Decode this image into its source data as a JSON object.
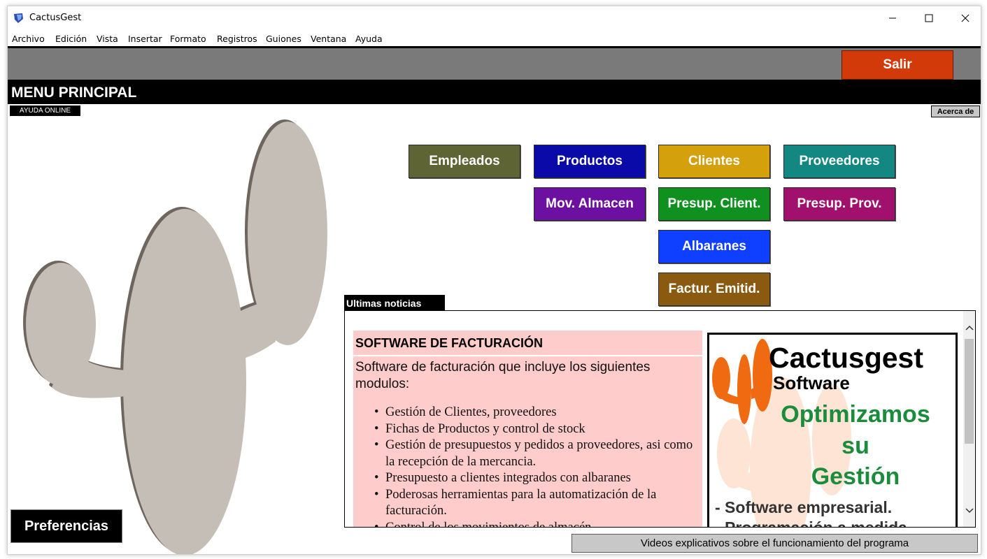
{
  "window": {
    "title": "CactusGest"
  },
  "menubar": {
    "items": [
      "Archivo",
      "Edición",
      "Vista",
      "Insertar",
      "Formato",
      "Registros",
      "Guiones",
      "Ventana",
      "Ayuda"
    ]
  },
  "toolbar": {
    "exit_label": "Salir"
  },
  "header": {
    "title": "MENU PRINCIPAL",
    "help_online": "AYUDA ONLINE",
    "about": "Acerca de"
  },
  "menu_buttons": {
    "empleados": "Empleados",
    "productos": "Productos",
    "clientes": "Clientes",
    "proveedores": "Proveedores",
    "mov_almacen": "Mov. Almacen",
    "presup_client": "Presup. Client.",
    "presup_prov": "Presup. Prov.",
    "albaranes": "Albaranes",
    "factur_emitid": "Factur. Emitid."
  },
  "colors": {
    "empleados": "#5f6435",
    "productos": "#0a0aa8",
    "clientes": "#d4a00c",
    "proveedores": "#138782",
    "mov_almacen": "#6b10a0",
    "presup_client": "#10901e",
    "presup_prov": "#a0106c",
    "albaranes": "#1040ff",
    "factur_emitid": "#8a5a10",
    "salir": "#d23a0a",
    "cactus": "#c5beb6"
  },
  "news": {
    "tab_label": "Ultimas noticias",
    "heading": "SOFTWARE DE FACTURACIÓN",
    "intro": "Software de facturación que incluye los siguientes modulos:",
    "items": [
      "Gestión de Clientes, proveedores",
      "Fichas de Productos y control de stock",
      "Gestión de presupuestos y pedidos a proveedores, asi como la recepción de la mercancia.",
      "Presupuesto a clientes integrados con albaranes",
      "Poderosas herramientas para la  automatización de la facturación.",
      "Control de los movimientos de almacén"
    ],
    "ad": {
      "brand": "Cactusgest",
      "software": "Software",
      "slogan_1": "Optimizamos",
      "slogan_2": "su",
      "slogan_3": "Gestión",
      "line_1": "- Software empresarial.",
      "line_2": "- Programación a medida"
    }
  },
  "footer": {
    "preferences": "Preferencias",
    "videos": "Videos explicativos sobre el funcionamiento del programa"
  }
}
